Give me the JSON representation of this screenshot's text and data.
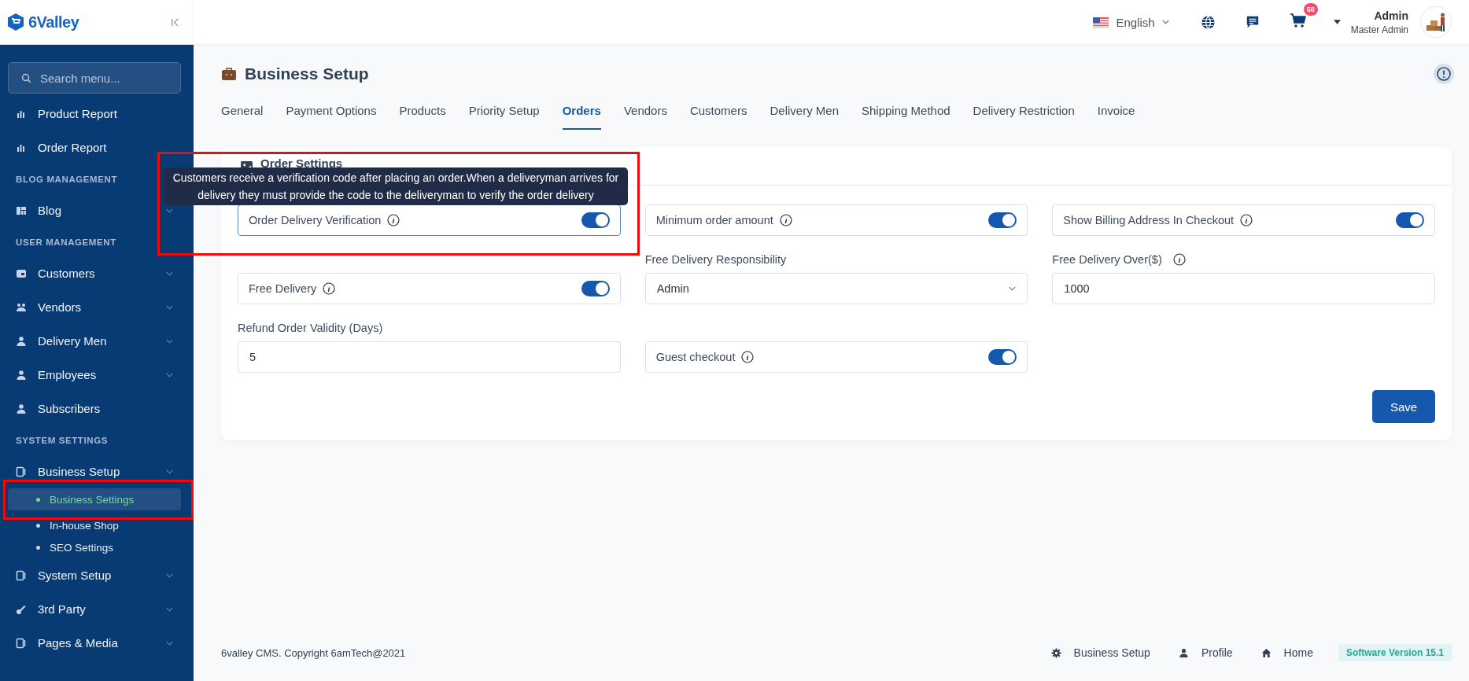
{
  "brand": {
    "name": "6Valley"
  },
  "sidebar": {
    "search": {
      "placeholder": "Search menu..."
    },
    "items": [
      {
        "kind": "item",
        "label": "Product Report",
        "expandable": false
      },
      {
        "kind": "item",
        "label": "Order Report",
        "expandable": false
      },
      {
        "kind": "heading",
        "label": "BLOG MANAGEMENT"
      },
      {
        "kind": "item",
        "label": "Blog",
        "expandable": true
      },
      {
        "kind": "heading",
        "label": "USER MANAGEMENT"
      },
      {
        "kind": "item",
        "label": "Customers",
        "expandable": true
      },
      {
        "kind": "item",
        "label": "Vendors",
        "expandable": true
      },
      {
        "kind": "item",
        "label": "Delivery Men",
        "expandable": true
      },
      {
        "kind": "item",
        "label": "Employees",
        "expandable": true
      },
      {
        "kind": "item",
        "label": "Subscribers",
        "expandable": false
      },
      {
        "kind": "heading",
        "label": "SYSTEM SETTINGS"
      },
      {
        "kind": "item",
        "label": "Business Setup",
        "expandable": true
      },
      {
        "kind": "sub",
        "label": "Business Settings",
        "selected": true
      },
      {
        "kind": "sub",
        "label": "In-house Shop",
        "selected": false
      },
      {
        "kind": "sub",
        "label": "SEO Settings",
        "selected": false
      },
      {
        "kind": "item",
        "label": "System Setup",
        "expandable": true
      },
      {
        "kind": "item",
        "label": "3rd Party",
        "expandable": true
      },
      {
        "kind": "item",
        "label": "Pages & Media",
        "expandable": true
      }
    ]
  },
  "header": {
    "language": "English",
    "cart_count": "58",
    "user_name": "Admin",
    "user_role": "Master Admin"
  },
  "page_title": "Business Setup",
  "tabs": [
    {
      "label": "General",
      "selected": false
    },
    {
      "label": "Payment Options",
      "selected": false
    },
    {
      "label": "Products",
      "selected": false
    },
    {
      "label": "Priority Setup",
      "selected": false
    },
    {
      "label": "Orders",
      "selected": true
    },
    {
      "label": "Vendors",
      "selected": false
    },
    {
      "label": "Customers",
      "selected": false
    },
    {
      "label": "Delivery Men",
      "selected": false
    },
    {
      "label": "Shipping Method",
      "selected": false
    },
    {
      "label": "Delivery Restriction",
      "selected": false
    },
    {
      "label": "Invoice",
      "selected": false
    }
  ],
  "card": {
    "title": "Order Settings",
    "tooltip": "Customers receive a verification code after placing an order.When a deliveryman arrives for delivery they must provide the code to the deliveryman to verify the order delivery",
    "fields": [
      {
        "kind": "toggle",
        "label": "Order Delivery Verification",
        "on": true,
        "focused": true
      },
      {
        "kind": "toggle",
        "label": "Minimum order amount",
        "on": true,
        "focused": false
      },
      {
        "kind": "toggle",
        "label": "Show Billing Address In Checkout",
        "on": true,
        "focused": false
      },
      {
        "kind": "toggle",
        "label": "Free Delivery",
        "on": true,
        "focused": false
      },
      {
        "kind": "select",
        "label": "Free Delivery Responsibility",
        "value": "Admin",
        "info": false
      },
      {
        "kind": "input",
        "label": "Free Delivery Over($)",
        "value": "1000",
        "info": true
      },
      {
        "kind": "input",
        "label": "Refund Order Validity (Days)",
        "value": "5",
        "info": false
      },
      {
        "kind": "toggle",
        "label": "Guest checkout",
        "on": true,
        "focused": false
      }
    ],
    "save": "Save"
  },
  "footer": {
    "copyright": "6valley CMS. Copyright 6amTech@2021",
    "links": [
      {
        "label": "Business Setup"
      },
      {
        "label": "Profile"
      },
      {
        "label": "Home"
      }
    ],
    "version": "Software Version 15.1"
  }
}
